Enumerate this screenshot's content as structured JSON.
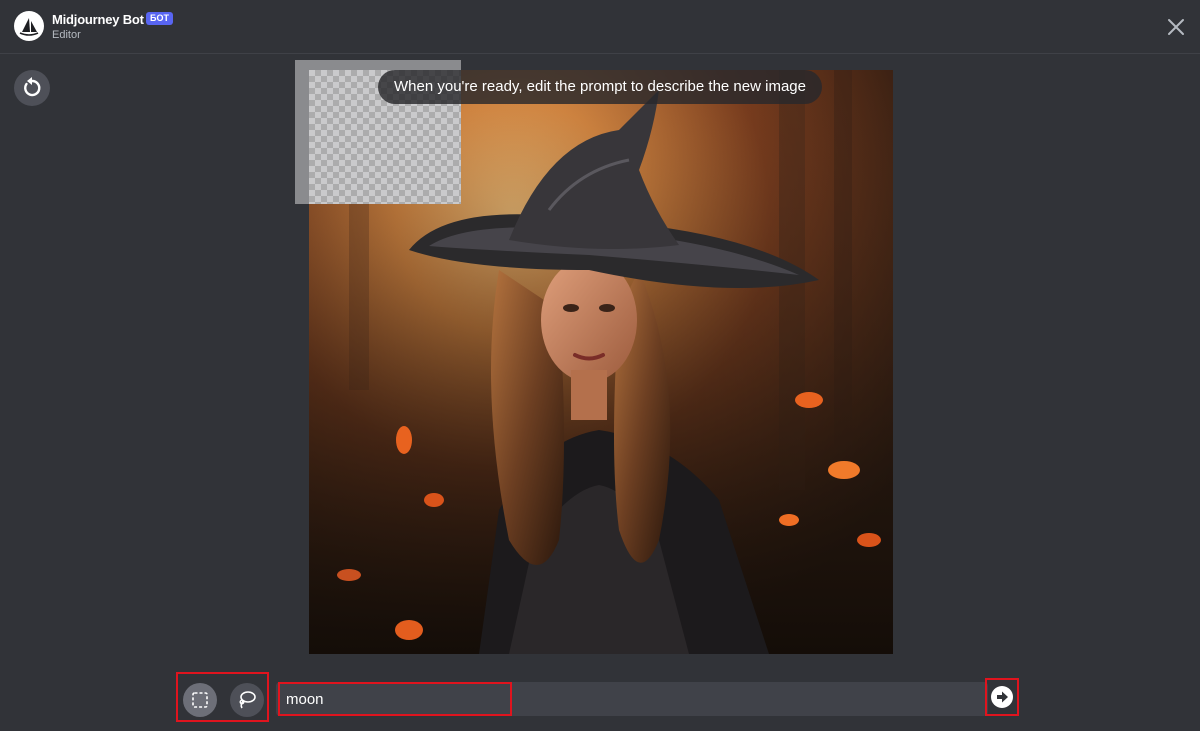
{
  "header": {
    "bot_name": "Midjourney Bot",
    "badge": "БОТ",
    "subtitle": "Editor",
    "avatar_icon": "midjourney-sailboat-icon",
    "close_icon": "close-icon"
  },
  "toolbar": {
    "reset_icon": "reset-icon",
    "rect_select_icon": "rectangle-select-icon",
    "lasso_icon": "lasso-icon",
    "submit_icon": "arrow-right-icon"
  },
  "tooltip": "When you're ready, edit the prompt to describe the new image",
  "prompt": {
    "value": "moon"
  },
  "colors": {
    "background": "#313338",
    "highlight": "#e0141e",
    "badge": "#5865f2"
  }
}
